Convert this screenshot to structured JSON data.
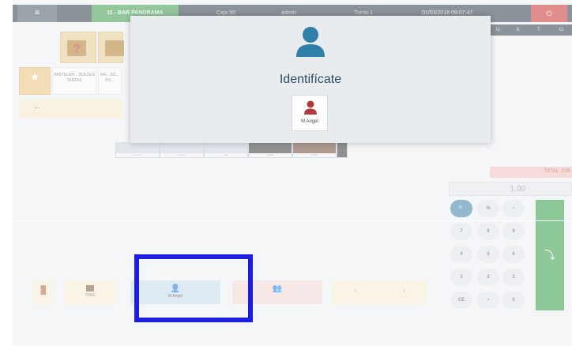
{
  "topbar": {
    "menu_icon": "≡",
    "table_label": "11 - BAR PANORAMA",
    "caja_label": "Caja 90",
    "user_label": "admin",
    "turno_label": "Turno 1",
    "datetime": "01/03/2018 09:07:47",
    "power_icon": "⏻"
  },
  "strip": {
    "a": "U.",
    "b": "€",
    "c": "T.",
    "d": "O."
  },
  "categories": {
    "star_icon": "★",
    "pasteles": "PASTELER... DULCES TARTAS",
    "fr": "FR... SO... PO..."
  },
  "back_arrow": "←",
  "thumbnails": [
    "refresco",
    "refresco",
    "cafe",
    "tostada",
    "comida",
    "postre"
  ],
  "keypad": {
    "total": "TOTAL: 0.00",
    "amount": "1.00",
    "keys": [
      "🔍",
      "%",
      "−",
      "7",
      "8",
      "9",
      "4",
      "5",
      "6",
      "1",
      "2",
      "3",
      "CE",
      "•",
      "0"
    ],
    "enter_icon": "⤵"
  },
  "actions": {
    "door_icon": "🚪",
    "tree_label": "TREE",
    "user_label": "M Angel",
    "user_icon": "👤",
    "group_icon": "👥",
    "up_arrow": "↑",
    "down_arrow": "↓"
  },
  "modal": {
    "title": "Identifícate",
    "user_name": "M Angel"
  },
  "colors": {
    "accent_blue": "#2f7fa8",
    "user_red": "#b23b3b",
    "highlight": "#1d1dde"
  }
}
